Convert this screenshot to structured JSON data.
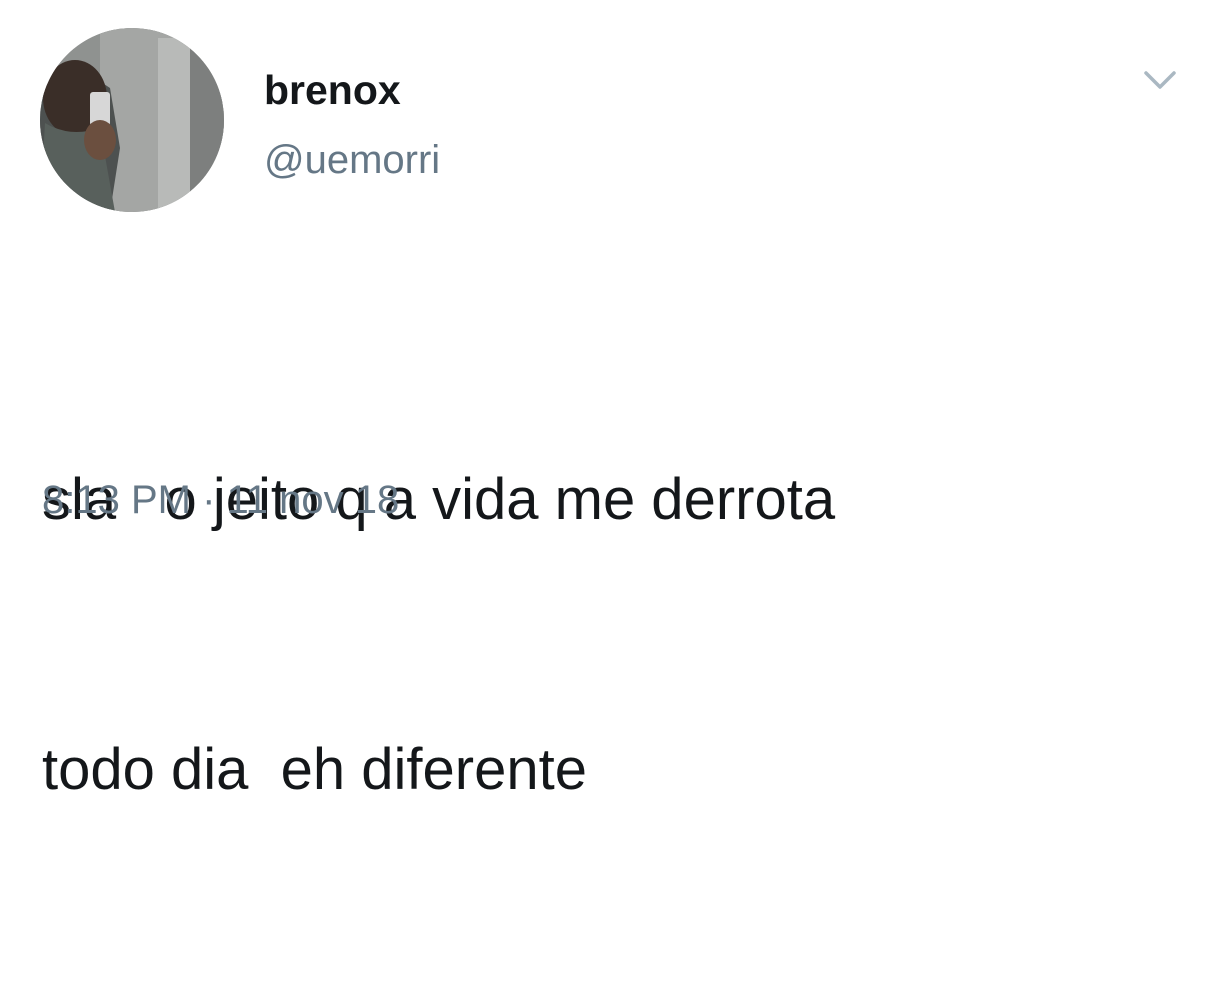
{
  "tweet": {
    "author": {
      "display_name": "brenox",
      "handle": "@uemorri",
      "avatar_icon": "profile-photo"
    },
    "menu_icon": "chevron-down-icon",
    "text_lines": [
      "sla   o jeito q a vida me derrota",
      "todo dia  eh diferente"
    ],
    "time": "8:13 PM",
    "separator": " · ",
    "date": "11 nov 18"
  },
  "colors": {
    "text_primary": "#14171a",
    "text_secondary": "#657786",
    "caret": "#aab8c2",
    "background": "#ffffff"
  }
}
